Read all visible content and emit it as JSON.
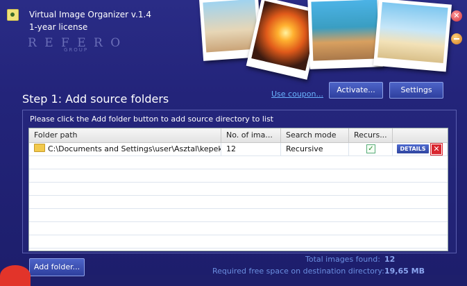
{
  "app": {
    "title": "Virtual Image Organizer v.1.4",
    "license": "1-year license",
    "logo": "REFERO",
    "logo_sub": "GROUP"
  },
  "header": {
    "coupon_link": "Use coupon...",
    "activate_label": "Activate...",
    "settings_label": "Settings"
  },
  "step": {
    "title": "Step 1: Add source folders",
    "instruction": "Please click the Add folder button to add source directory to list"
  },
  "table": {
    "columns": [
      "Folder path",
      "No. of ima...",
      "Search mode",
      "Recurs...",
      ""
    ],
    "rows": [
      {
        "folder_path": "C:\\Documents and Settings\\user\\Asztal\\kepek",
        "num_images": "12",
        "search_mode": "Recursive",
        "recursive_checked": true,
        "details_label": "DETAILS"
      }
    ]
  },
  "footer": {
    "add_folder_label": "Add folder...",
    "total_images_label": "Total images found:",
    "total_images_value": "12",
    "free_space_label": "Required free space on destination directory:",
    "free_space_value": "19,65 MB"
  },
  "colors": {
    "background": "#23247a",
    "button": "#3a4fb5",
    "close": "#d0303a",
    "minimize": "#d07a20",
    "delete": "#d8252e",
    "link": "#6ab4ff"
  }
}
